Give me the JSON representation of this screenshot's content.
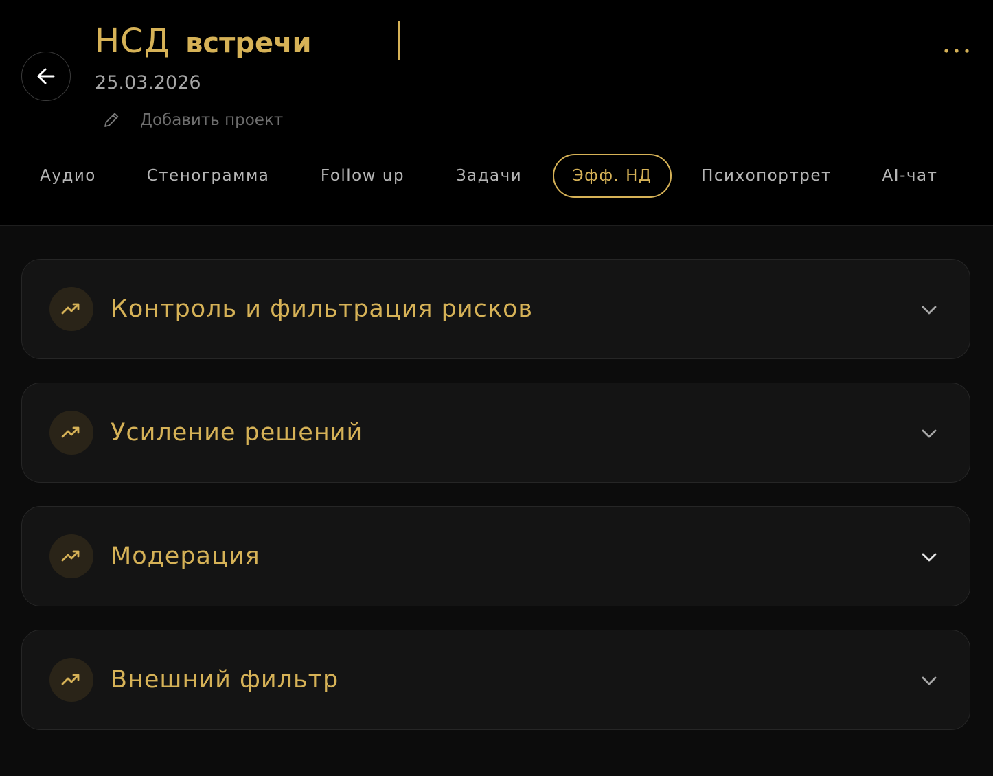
{
  "header": {
    "title": "НСД",
    "title_suffix": "встречи",
    "date": "25.03.2026",
    "add_project_label": "Добавить проект",
    "back_icon": "arrow-left-icon",
    "edit_icon": "pencil-icon",
    "more_icon": "more-horizontal-icon"
  },
  "tabs": [
    {
      "label": "Аудио",
      "active": false
    },
    {
      "label": "Стенограмма",
      "active": false
    },
    {
      "label": "Follow up",
      "active": false
    },
    {
      "label": "Задачи",
      "active": false
    },
    {
      "label": "Эфф. НД",
      "active": true
    },
    {
      "label": "Психопортрет",
      "active": false
    },
    {
      "label": "AI-чат",
      "active": false
    }
  ],
  "sections": [
    {
      "title": "Контроль и фильтрация рисков",
      "icon": "trending-up-icon",
      "expanded": false
    },
    {
      "title": "Усиление решений",
      "icon": "trending-up-icon",
      "expanded": false
    },
    {
      "title": "Модерация",
      "icon": "trending-up-icon",
      "expanded": false
    },
    {
      "title": "Внешний фильтр",
      "icon": "trending-up-icon",
      "expanded": false
    }
  ],
  "colors": {
    "accent": "#d6b257",
    "header_bg": "#000000",
    "page_bg": "#0c0c0c",
    "card_bg": "#141414",
    "card_border": "#262626",
    "muted_text": "#b5b5b5"
  }
}
